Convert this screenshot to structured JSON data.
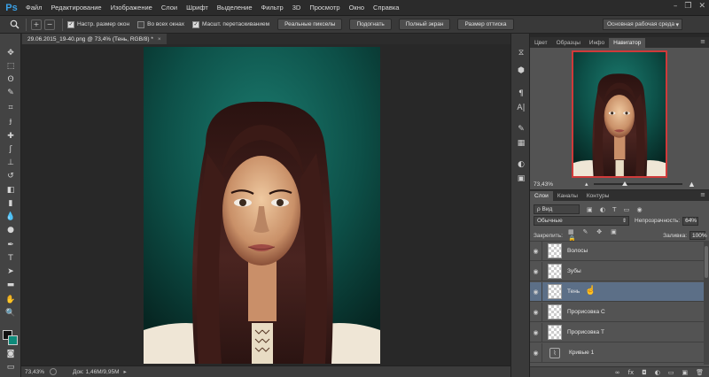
{
  "app": {
    "logo": "Ps"
  },
  "menu": [
    "Файл",
    "Редактирование",
    "Изображение",
    "Слои",
    "Шрифт",
    "Выделение",
    "Фильтр",
    "3D",
    "Просмотр",
    "Окно",
    "Справка"
  ],
  "window_controls": {
    "minimize": "–",
    "restore": "❐",
    "close": "✕"
  },
  "options_bar": {
    "tool_icon": "zoom-icon",
    "zoom_in": "+",
    "zoom_out": "−",
    "check_resize_windows": "Настр. размер окон",
    "check_all_windows": "Во всех окнах",
    "check_scrubby_zoom": "Масшт. перетаскиванием",
    "btn_actual_pixels": "Реальные пикселы",
    "btn_fit": "Подогнать",
    "btn_fill_screen": "Полный экран",
    "btn_print_size": "Размер оттиска",
    "workspace": "Основная рабочая среда"
  },
  "document": {
    "tab_title": "29.06.2015_19-40.png @ 73,4% (Тень, RGB/8) *",
    "tab_close": "×"
  },
  "statusbar": {
    "zoom": "73,43%",
    "doc_info": "Док: 1,46M/9,95M",
    "arrow": "▸"
  },
  "navigator_panel": {
    "tabs": [
      "Цвет",
      "Образцы",
      "Инфо",
      "Навигатор"
    ],
    "active_tab": "Навигатор",
    "zoom": "73,43%",
    "menu_icon": "≡",
    "zoom_out_icon": "▴",
    "zoom_in_icon": "▲"
  },
  "layers_panel": {
    "tabs": [
      "Слои",
      "Каналы",
      "Контуры"
    ],
    "active_tab": "Слои",
    "menu_icon": "≡",
    "kind_filter": "ρ Вид",
    "filter_icons": "▣ ◐ T ▭ ◉",
    "blend_mode": "Обычные",
    "opacity_label": "Непрозрачность:",
    "opacity_value": "64%",
    "lock_label": "Закрепить:",
    "lock_icons": "▦ ✎ ✥ ▣ 🔒",
    "fill_label": "Заливка:",
    "fill_value": "100%",
    "layers": [
      {
        "name": "Волосы",
        "visible": true,
        "selected": false,
        "type": "raster"
      },
      {
        "name": "Зубы",
        "visible": true,
        "selected": false,
        "type": "raster"
      },
      {
        "name": "Тень",
        "visible": true,
        "selected": true,
        "type": "raster"
      },
      {
        "name": "Прорисовка С",
        "visible": true,
        "selected": false,
        "type": "raster"
      },
      {
        "name": "Прорисовка Т",
        "visible": true,
        "selected": false,
        "type": "raster"
      },
      {
        "name": "Кривые 1",
        "visible": true,
        "selected": false,
        "type": "adjustment"
      }
    ],
    "footer_icons": [
      "∞",
      "fx",
      "◘",
      "◐",
      "▭",
      "▣",
      "🗑"
    ],
    "eye_icon": "◉",
    "adjustment_icon": "⌇"
  },
  "colors": {
    "bg_teal": "#0e5a52",
    "hair": "#3a1d17",
    "skin": "#e0b48a",
    "selected_layer": "#5c6f87",
    "navigator_frame": "#cf3a3a"
  }
}
